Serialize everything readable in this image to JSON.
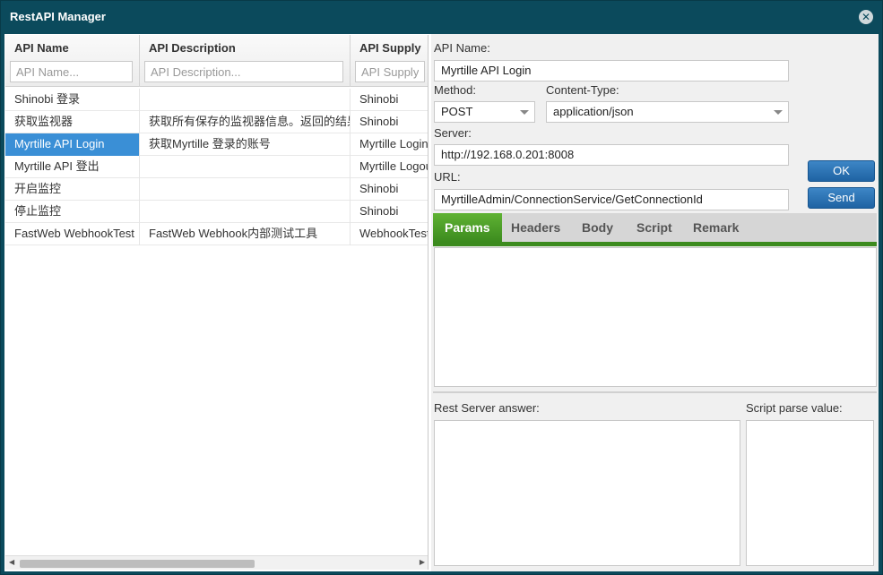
{
  "window": {
    "title": "RestAPI Manager"
  },
  "grid": {
    "columns": [
      {
        "label": "API Name",
        "placeholder": "API Name..."
      },
      {
        "label": "API Description",
        "placeholder": "API Description..."
      },
      {
        "label": "API Supply",
        "placeholder": "API Supply..."
      }
    ],
    "rows": [
      {
        "name": "Shinobi 登录",
        "description": "",
        "supply": "Shinobi"
      },
      {
        "name": "获取监视器",
        "description": "获取所有保存的监视器信息。返回的结果",
        "supply": "Shinobi"
      },
      {
        "name": "Myrtille API Login",
        "description": "获取Myrtille 登录的账号",
        "supply": "Myrtille Login"
      },
      {
        "name": "Myrtille API 登出",
        "description": "",
        "supply": "Myrtille Logout"
      },
      {
        "name": "开启监控",
        "description": "",
        "supply": "Shinobi"
      },
      {
        "name": "停止监控",
        "description": "",
        "supply": "Shinobi"
      },
      {
        "name": "FastWeb WebhookTest",
        "description": "FastWeb Webhook内部测试工具",
        "supply": "WebhookTest"
      }
    ],
    "selected_row": 2
  },
  "form": {
    "api_name_label": "API Name:",
    "api_name_value": "Myrtille API Login",
    "method_label": "Method:",
    "method_value": "POST",
    "content_type_label": "Content-Type:",
    "content_type_value": "application/json",
    "server_label": "Server:",
    "server_value": "http://192.168.0.201:8008",
    "url_label": "URL:",
    "url_value": "MyrtilleAdmin/ConnectionService/GetConnectionId",
    "ok_label": "OK",
    "send_label": "Send",
    "tabs": [
      "Params",
      "Headers",
      "Body",
      "Script",
      "Remark"
    ],
    "active_tab": "Params",
    "answer_label": "Rest Server answer:",
    "parse_label": "Script parse value:"
  },
  "colors": {
    "titlebar": "#0b4a5c",
    "selected_row": "#3a8fd6",
    "tab_active": "#3c8b1e",
    "button": "#1f63a3"
  }
}
